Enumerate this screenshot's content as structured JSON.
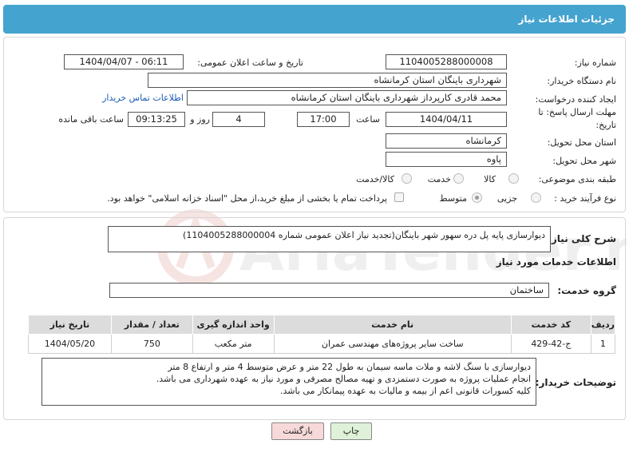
{
  "header": {
    "title": "جزئیات اطلاعات نیاز"
  },
  "form": {
    "need_number_label": "شماره نیاز:",
    "need_number": "1104005288000008",
    "announce_label": "تاریخ و ساعت اعلان عمومی:",
    "announce_value": "1404/04/07 - 06:11",
    "buyer_org_label": "نام دستگاه خریدار:",
    "buyer_org": "شهرداری باینگان استان کرمانشاه",
    "creator_label": "ایجاد کننده درخواست:",
    "creator": "محمد قادری کارپرداز شهرداری باینگان استان کرمانشاه",
    "buyer_contact_link": "اطلاعات تماس خریدار",
    "deadline_label_1": "مهلت ارسال پاسخ: تا",
    "deadline_label_2": "تاریخ:",
    "deadline_date": "1404/04/11",
    "time_label": "ساعت",
    "deadline_time": "17:00",
    "days_value": "4",
    "days_label": "روز و",
    "remaining_time": "09:13:25",
    "remaining_label": "ساعت باقی مانده",
    "province_label": "استان محل تحویل:",
    "province": "کرمانشاه",
    "city_label": "شهر محل تحویل:",
    "city": "پاوه",
    "category_label": "طبقه بندی موضوعی:",
    "category_options": [
      "کالا",
      "خدمت",
      "کالا/خدمت"
    ],
    "process_label": "نوع فرآیند خرید :",
    "process_options": [
      "جزیی",
      "متوسط"
    ],
    "payment_note": "پرداخت تمام یا بخشی از مبلغ خرید،از محل \"اسناد خزانه اسلامی\" خواهد بود."
  },
  "summary": {
    "label": "شرح کلی نیاز:",
    "text": "دیوارسازی پایه پل دره سهور شهر باینگان(تجدید نیاز اعلان عمومی شماره 1104005288000004)"
  },
  "services": {
    "title": "اطلاعات خدمات مورد نیاز",
    "group_label": "گروه خدمت:",
    "group_value": "ساختمان",
    "table": {
      "headers": [
        "ردیف",
        "کد خدمت",
        "نام خدمت",
        "واحد اندازه گیری",
        "تعداد / مقدار",
        "تاریخ نیاز"
      ],
      "rows": [
        [
          "1",
          "ج-42-429",
          "ساخت سایر پروژه‌های مهندسی عمران",
          "متر مکعب",
          "750",
          "1404/05/20"
        ]
      ]
    }
  },
  "buyer_notes": {
    "label": "توضیحات خریدار:",
    "lines": [
      "دیوارسازی با سنگ لاشه و ملات ماسه سیمان به طول 22 متر و عرض متوسط 4 متر و ارتفاع 8 متر",
      "انجام عملیات پروژه به صورت دستمزدی و تهیه مصالح مصرفی و مورد نیاز به عهده شهرداری می باشد.",
      "کلیه کسورات قانونی اعم از بیمه و مالیات به عهده پیمانکار می باشد."
    ]
  },
  "buttons": {
    "print": "چاپ",
    "back": "بازگشت"
  },
  "watermark": {
    "text": "AriaTender.neT"
  },
  "colors": {
    "header": "#44a3cf",
    "link": "#1a5bb3",
    "back_button": "#f7d9d9",
    "print_button": "#dff2d9"
  }
}
